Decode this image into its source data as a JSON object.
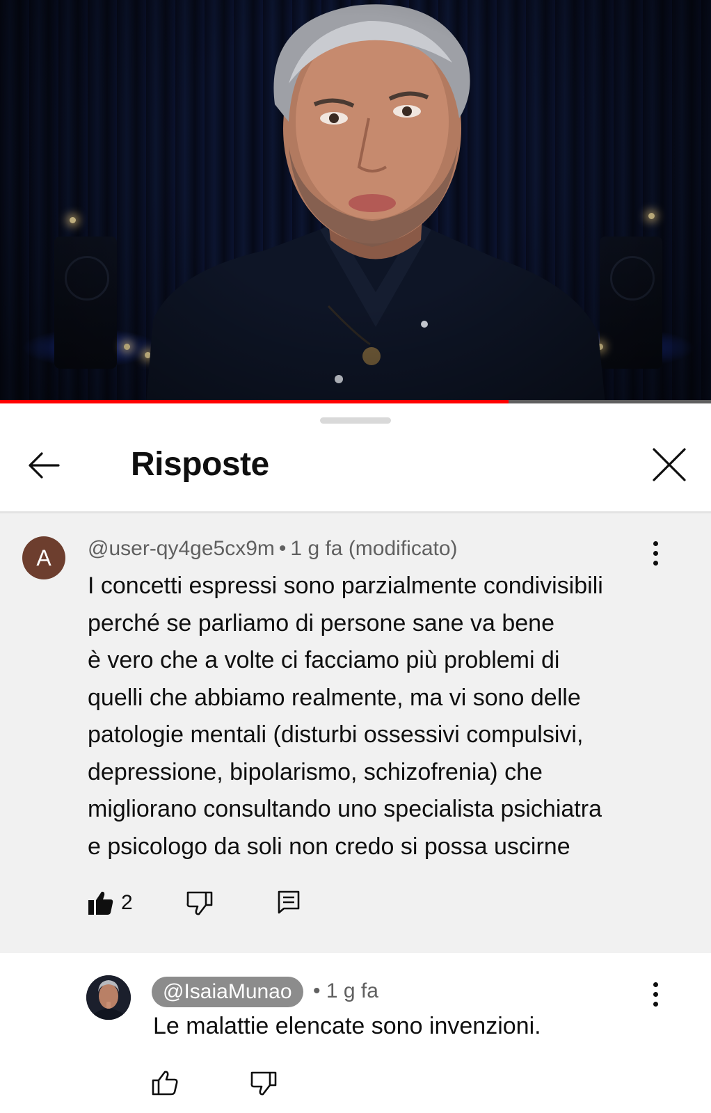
{
  "video": {
    "progress_fraction": 0.715,
    "colors": {
      "progress_played": "#ff0000",
      "progress_track": "#5f5f5f"
    }
  },
  "sheet": {
    "title": "Risposte",
    "icons": {
      "back": "arrow-left-icon",
      "close": "close-icon"
    }
  },
  "comment": {
    "avatar_letter": "A",
    "avatar_color": "#6d3e2e",
    "author": "@user-qy4ge5cx9m",
    "separator": "•",
    "time": "1 g fa (modificato)",
    "lines": [
      "I concetti espressi sono parzialmente condivisibili",
      "perché se parliamo di persone sane va bene",
      "è vero che a volte ci facciamo più problemi di",
      "quelli che abbiamo realmente, ma vi sono delle",
      "patologie mentali (disturbi ossessivi compulsivi,",
      "depressione, bipolarismo, schizofrenia) che",
      "migliorano consultando uno specialista psichiatra",
      "e psicologo da soli non credo si possa uscirne"
    ],
    "likes": "2",
    "liked": true,
    "icons": {
      "like": "thumbs-up-filled-icon",
      "dislike": "thumbs-down-icon",
      "reply": "comment-icon",
      "more": "more-vert-icon"
    }
  },
  "reply": {
    "author": "@IsaiaMunao",
    "separator": "•",
    "time": "1 g fa",
    "text": "Le malattie elencate sono invenzioni.",
    "icons": {
      "like": "thumbs-up-icon",
      "dislike": "thumbs-down-icon",
      "more": "more-vert-icon"
    }
  }
}
